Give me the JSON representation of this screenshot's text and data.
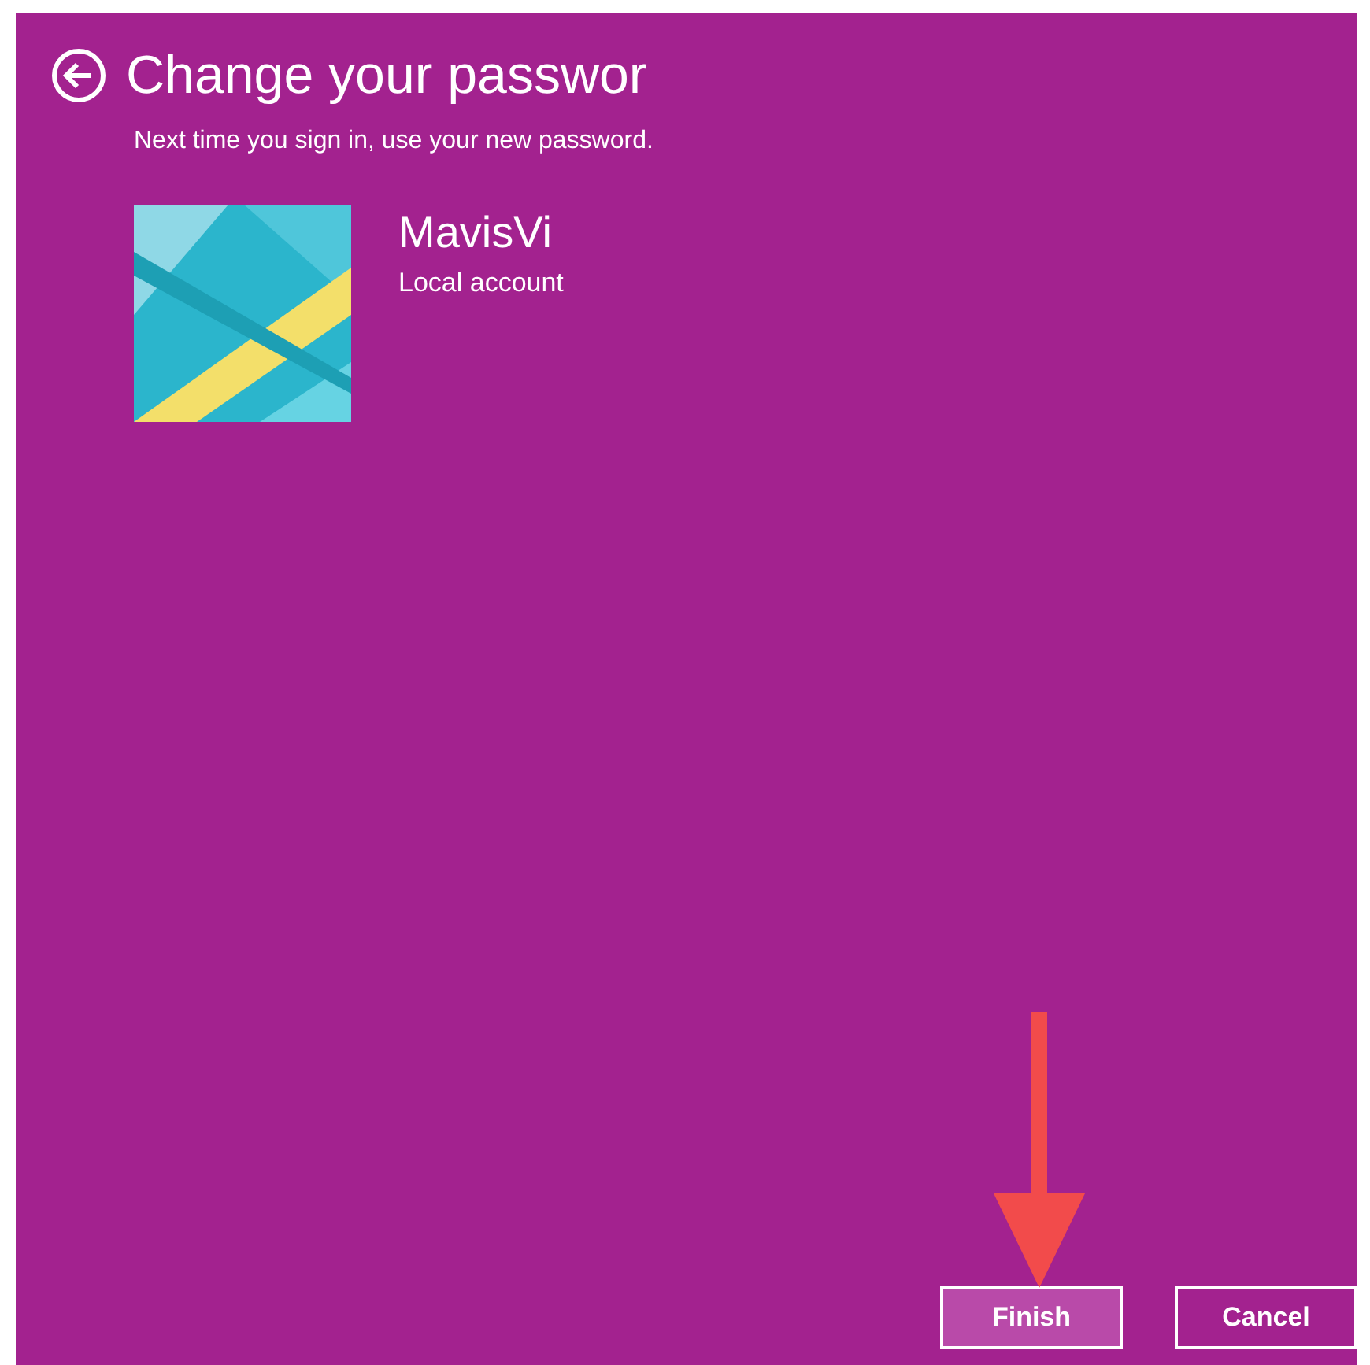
{
  "header": {
    "title": "Change your passwor",
    "subtitle": "Next time you sign in, use your new password."
  },
  "account": {
    "name": "MavisVi",
    "type": "Local account"
  },
  "buttons": [
    {
      "label": "Finish",
      "selected": true
    },
    {
      "label": "Cancel",
      "selected": false
    }
  ]
}
